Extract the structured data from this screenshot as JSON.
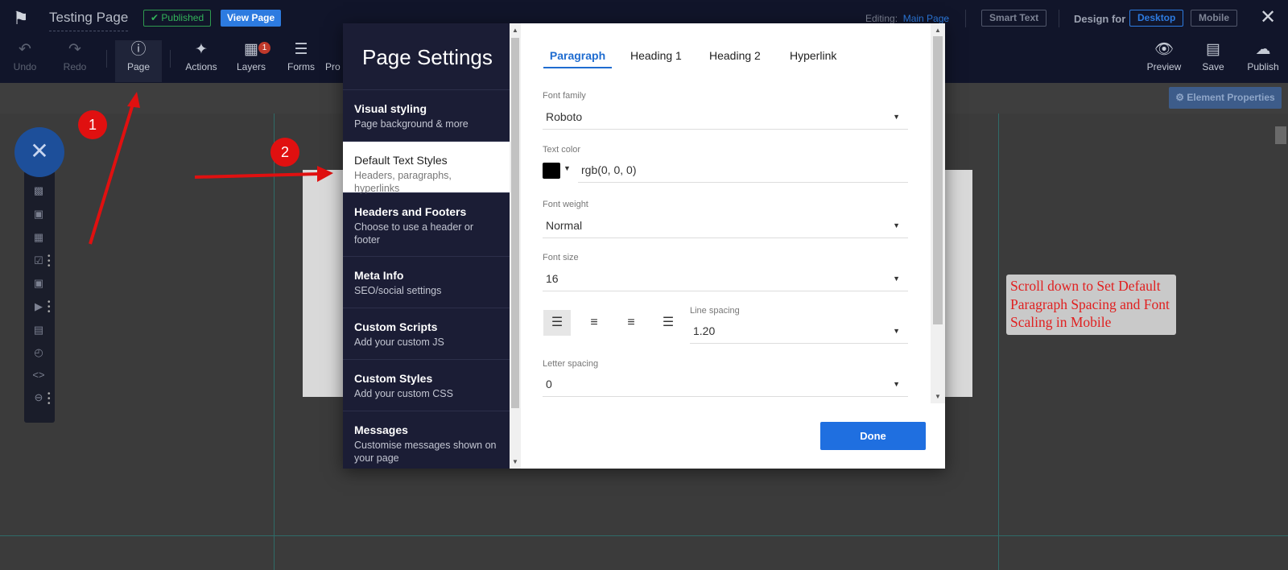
{
  "header": {
    "title": "Testing Page",
    "published_badge": "Published",
    "view_page": "View Page",
    "editing_label": "Editing:",
    "editing_value": "Main Page",
    "smart_text": "Smart Text",
    "design_for": "Design for",
    "desktop": "Desktop",
    "mobile": "Mobile"
  },
  "toolbar": {
    "undo": "Undo",
    "redo": "Redo",
    "page": "Page",
    "actions": "Actions",
    "layers": "Layers",
    "layers_count": "1",
    "forms": "Forms",
    "pro_partial": "Pro",
    "preview": "Preview",
    "save": "Save",
    "publish": "Publish"
  },
  "element_properties": "Element Properties",
  "annotations": {
    "step1": "1",
    "step2": "2",
    "note": "Scroll down to Set Default Paragraph Spacing and Font Scaling in Mobile"
  },
  "modal": {
    "title": "Page Settings",
    "items": [
      {
        "title": "Visual styling",
        "subtitle": "Page background & more"
      },
      {
        "title": "Default Text Styles",
        "subtitle": "Headers, paragraphs, hyperlinks"
      },
      {
        "title": "Headers and Footers",
        "subtitle": "Choose to use a header or footer"
      },
      {
        "title": "Meta Info",
        "subtitle": "SEO/social settings"
      },
      {
        "title": "Custom Scripts",
        "subtitle": "Add your custom JS"
      },
      {
        "title": "Custom Styles",
        "subtitle": "Add your custom CSS"
      },
      {
        "title": "Messages",
        "subtitle": "Customise messages shown on your page"
      }
    ],
    "tabs": [
      "Paragraph",
      "Heading 1",
      "Heading 2",
      "Hyperlink"
    ],
    "fields": {
      "font_family_label": "Font family",
      "font_family": "Roboto",
      "text_color_label": "Text color",
      "text_color": "rgb(0, 0, 0)",
      "font_weight_label": "Font weight",
      "font_weight": "Normal",
      "font_size_label": "Font size",
      "font_size": "16",
      "line_spacing_label": "Line spacing",
      "line_spacing": "1.20",
      "letter_spacing_label": "Letter spacing",
      "letter_spacing": "0"
    },
    "done": "Done"
  },
  "colors": {
    "accent": "#1f6fe0",
    "topbar": "#11152a",
    "modal_sidebar": "#1b1d35",
    "annotation_red": "#e01010"
  }
}
